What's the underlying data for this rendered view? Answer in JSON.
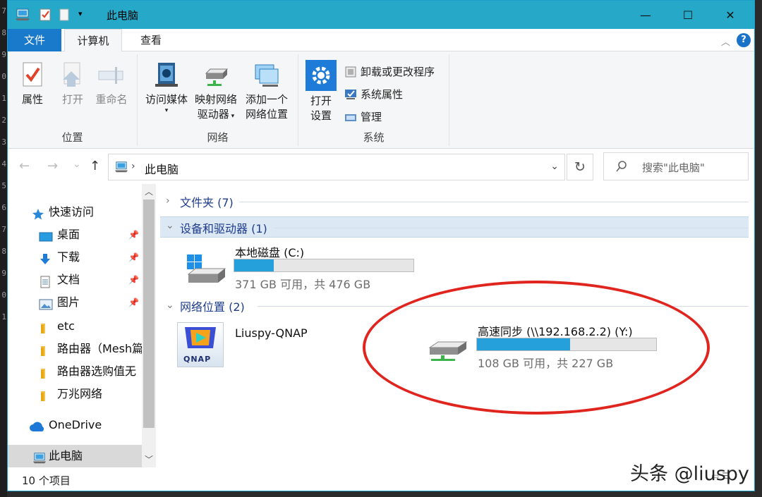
{
  "edge_line_numbers": [
    "7",
    "8",
    "9",
    "0",
    "1",
    "2",
    "3",
    "4",
    "5",
    "6",
    "7",
    "8",
    "9",
    "0",
    "1"
  ],
  "titlebar": {
    "title": "此电脑",
    "qat_more": "▾",
    "min": "—",
    "max": "☐",
    "close": "✕"
  },
  "tabs": {
    "file": "文件",
    "computer": "计算机",
    "view": "查看"
  },
  "ribbon": {
    "groups": {
      "location": "位置",
      "network": "网络",
      "system": "系统"
    },
    "properties": "属性",
    "open": "打开",
    "rename": "重命名",
    "access_media_line1": "访问媒体",
    "map_drive_line1": "映射网络",
    "map_drive_line2": "驱动器",
    "add_location_line1": "添加一个",
    "add_location_line2": "网络位置",
    "open_settings_line1": "打开",
    "open_settings_line2": "设置",
    "uninstall": "卸载或更改程序",
    "system_props": "系统属性",
    "manage": "管理",
    "help": "?"
  },
  "nav": {
    "back": "←",
    "forward": "→",
    "recent": "⌄",
    "up": "↑",
    "address": "此电脑",
    "refresh": "↻",
    "search_placeholder": "搜索\"此电脑\""
  },
  "sidebar": {
    "quick_access": "快速访问",
    "items": [
      {
        "label": "桌面",
        "pinned": true
      },
      {
        "label": "下载",
        "pinned": true
      },
      {
        "label": "文档",
        "pinned": true
      },
      {
        "label": "图片",
        "pinned": true
      },
      {
        "label": "etc",
        "pinned": false
      },
      {
        "label": "路由器（Mesh篇",
        "pinned": false
      },
      {
        "label": "路由器选购值无",
        "pinned": false
      },
      {
        "label": "万兆网络",
        "pinned": false
      }
    ],
    "onedrive": "OneDrive",
    "this_pc": "此电脑"
  },
  "groups": {
    "folders": "文件夹 (7)",
    "devices": "设备和驱动器 (1)",
    "network": "网络位置 (2)"
  },
  "drives": {
    "c": {
      "name": "本地磁盘 (C:)",
      "space": "371 GB 可用，共 476 GB",
      "used_fraction": 0.22
    },
    "y": {
      "name": "高速同步 (\\\\192.168.2.2) (Y:)",
      "space": "108 GB 可用，共 227 GB",
      "used_fraction": 0.52
    }
  },
  "network_items": {
    "qnap": "Liuspy-QNAP",
    "qnap_logo": "QNAP"
  },
  "status": {
    "count": "10 个项目"
  },
  "watermark": "头条 @liuspy",
  "colors": {
    "title_bar": "#26a9c8",
    "file_tab": "#1979ca",
    "drive_fill": "#26a0da",
    "annotation": "#e0251f"
  }
}
